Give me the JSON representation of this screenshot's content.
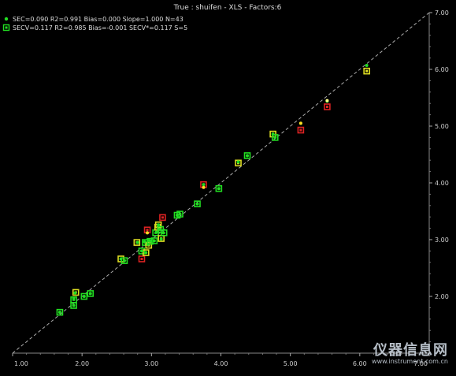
{
  "chart_data": {
    "type": "scatter",
    "title": "True : shuifen - XLS - Factors:6",
    "xlabel": "",
    "ylabel": "",
    "xlim": [
      1.0,
      7.0
    ],
    "ylim": [
      1.0,
      7.0
    ],
    "x_ticks": [
      "1.00",
      "2.00",
      "3.00",
      "4.00",
      "5.00",
      "6.00",
      "7.00"
    ],
    "y_ticks": [
      "2.00",
      "3.00",
      "4.00",
      "5.00",
      "6.00",
      "7.00"
    ],
    "grid": false,
    "legend_position": "top-left",
    "reference_line": "y = x (dashed)",
    "series": [
      {
        "name": "SEC=0.090 R2=0.991 Bias=0.000 Slope=1.000 N=43",
        "marker": "dot",
        "color": "#22dd22",
        "points": [
          {
            "x": 1.68,
            "y": 1.72
          },
          {
            "x": 1.88,
            "y": 1.84
          },
          {
            "x": 1.88,
            "y": 1.96
          },
          {
            "x": 1.9,
            "y": 2.06
          },
          {
            "x": 2.03,
            "y": 2.0
          },
          {
            "x": 2.12,
            "y": 2.05
          },
          {
            "x": 2.56,
            "y": 2.66
          },
          {
            "x": 2.61,
            "y": 2.63
          },
          {
            "x": 2.8,
            "y": 2.95
          },
          {
            "x": 2.86,
            "y": 2.8
          },
          {
            "x": 2.9,
            "y": 2.96
          },
          {
            "x": 2.92,
            "y": 2.77
          },
          {
            "x": 2.95,
            "y": 2.92
          },
          {
            "x": 2.97,
            "y": 2.98
          },
          {
            "x": 3.04,
            "y": 2.98
          },
          {
            "x": 3.07,
            "y": 3.13
          },
          {
            "x": 3.1,
            "y": 3.26
          },
          {
            "x": 3.12,
            "y": 3.18
          },
          {
            "x": 3.14,
            "y": 3.01
          },
          {
            "x": 3.17,
            "y": 3.12
          },
          {
            "x": 3.37,
            "y": 3.43
          },
          {
            "x": 3.41,
            "y": 3.45
          },
          {
            "x": 3.66,
            "y": 3.63
          },
          {
            "x": 3.75,
            "y": 3.97
          },
          {
            "x": 3.97,
            "y": 3.9
          },
          {
            "x": 4.25,
            "y": 4.37
          },
          {
            "x": 4.38,
            "y": 4.48
          },
          {
            "x": 4.75,
            "y": 4.86
          },
          {
            "x": 4.78,
            "y": 4.8
          },
          {
            "x": 5.15,
            "y": 5.05
          },
          {
            "x": 5.53,
            "y": 5.44
          },
          {
            "x": 6.1,
            "y": 6.07
          }
        ]
      },
      {
        "name": "SECV=0.117 R2=0.985 Bias=-0.001 SECV*=0.117 S=5",
        "marker": "square",
        "color": "#22dd22",
        "points": [
          {
            "x": 1.68,
            "y": 1.72,
            "c": "#22dd22"
          },
          {
            "x": 1.88,
            "y": 1.84,
            "c": "#22dd22"
          },
          {
            "x": 1.88,
            "y": 1.94,
            "c": "#22dd22"
          },
          {
            "x": 1.91,
            "y": 2.07,
            "c": "#dddd22"
          },
          {
            "x": 2.03,
            "y": 2.0,
            "c": "#22dd22"
          },
          {
            "x": 2.12,
            "y": 2.05,
            "c": "#22dd22"
          },
          {
            "x": 2.56,
            "y": 2.66,
            "c": "#dddd22"
          },
          {
            "x": 2.61,
            "y": 2.63,
            "c": "#22dd22"
          },
          {
            "x": 2.79,
            "y": 2.95,
            "c": "#dddd22"
          },
          {
            "x": 2.86,
            "y": 2.8,
            "c": "#22dd22"
          },
          {
            "x": 2.86,
            "y": 2.66,
            "c": "#dd2222"
          },
          {
            "x": 2.91,
            "y": 2.95,
            "c": "#22dd22"
          },
          {
            "x": 2.92,
            "y": 2.77,
            "c": "#dddd22"
          },
          {
            "x": 2.94,
            "y": 3.17,
            "c": "#dd2222"
          },
          {
            "x": 2.96,
            "y": 2.9,
            "c": "#dddd22"
          },
          {
            "x": 2.98,
            "y": 2.97,
            "c": "#22dd22"
          },
          {
            "x": 3.04,
            "y": 2.98,
            "c": "#22dd22"
          },
          {
            "x": 3.06,
            "y": 3.12,
            "c": "#22dd22"
          },
          {
            "x": 3.09,
            "y": 3.22,
            "c": "#dddd22"
          },
          {
            "x": 3.1,
            "y": 3.26,
            "c": "#dddd22"
          },
          {
            "x": 3.13,
            "y": 3.18,
            "c": "#22dd22"
          },
          {
            "x": 3.14,
            "y": 3.02,
            "c": "#dddd22"
          },
          {
            "x": 3.16,
            "y": 3.39,
            "c": "#dd2222"
          },
          {
            "x": 3.18,
            "y": 3.12,
            "c": "#22dd22"
          },
          {
            "x": 3.37,
            "y": 3.43,
            "c": "#22dd22"
          },
          {
            "x": 3.41,
            "y": 3.45,
            "c": "#22dd22"
          },
          {
            "x": 3.66,
            "y": 3.63,
            "c": "#22dd22"
          },
          {
            "x": 3.75,
            "y": 3.97,
            "c": "#dd2222"
          },
          {
            "x": 3.97,
            "y": 3.9,
            "c": "#22dd22"
          },
          {
            "x": 4.25,
            "y": 4.35,
            "c": "#dddd22"
          },
          {
            "x": 4.38,
            "y": 4.48,
            "c": "#22dd22"
          },
          {
            "x": 4.75,
            "y": 4.86,
            "c": "#dddd22"
          },
          {
            "x": 4.78,
            "y": 4.8,
            "c": "#22dd22"
          },
          {
            "x": 5.15,
            "y": 4.93,
            "c": "#dd2222"
          },
          {
            "x": 5.53,
            "y": 5.34,
            "c": "#dd2222"
          },
          {
            "x": 6.1,
            "y": 5.97,
            "c": "#dddd22"
          }
        ]
      }
    ],
    "extra_dots": [
      {
        "x": 3.75,
        "y": 3.92,
        "c": "#ffdd22"
      },
      {
        "x": 5.15,
        "y": 5.05,
        "c": "#ffdd22"
      },
      {
        "x": 5.53,
        "y": 5.45,
        "c": "#ffff88"
      },
      {
        "x": 2.94,
        "y": 3.12,
        "c": "#ffdd22"
      }
    ]
  },
  "watermark": {
    "text": "仪器信息网",
    "subtext": "www.instrument.com.cn"
  }
}
